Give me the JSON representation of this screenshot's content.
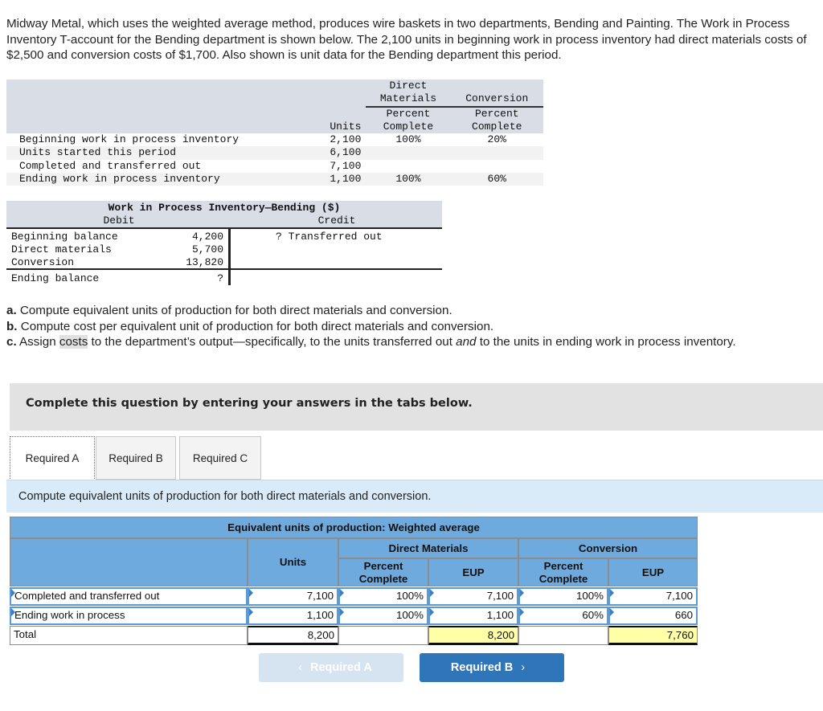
{
  "intro": "Midway Metal, which uses the weighted average method, produces wire baskets in two departments, Bending and Painting. The Work in Process Inventory T-account for the Bending department is shown below. The 2,100 units in beginning work in process inventory had direct materials costs of $2,500 and conversion costs of $1,700. Also shown is unit data for the Bending department this period.",
  "unit_table": {
    "headers": {
      "dm_top1": "Direct",
      "dm_top2": "Materials",
      "conv_top": "Conversion",
      "units": "Units",
      "pc1": "Percent",
      "pc2": "Complete"
    },
    "rows": [
      {
        "label": "Beginning work in process inventory",
        "units": "2,100",
        "dm": "100%",
        "conv": "20%"
      },
      {
        "label": "Units started this period",
        "units": "6,100",
        "dm": "",
        "conv": ""
      },
      {
        "label": "Completed and transferred out",
        "units": "7,100",
        "dm": "",
        "conv": ""
      },
      {
        "label": "Ending work in process inventory",
        "units": "1,100",
        "dm": "100%",
        "conv": "60%"
      }
    ]
  },
  "t_account": {
    "title": "Work in Process Inventory—Bending ($)",
    "debit": "Debit",
    "credit": "Credit",
    "debits": [
      {
        "label": "Beginning balance",
        "value": "4,200"
      },
      {
        "label": "Direct materials",
        "value": "5,700"
      },
      {
        "label": "Conversion",
        "value": "13,820"
      }
    ],
    "ending": {
      "label": "Ending balance",
      "value": "?"
    },
    "credit_entry": "? Transferred out"
  },
  "requirements": {
    "a_prefix": "a.",
    "a": " Compute equivalent units of production for both direct materials and conversion.",
    "b_prefix": "b.",
    "b": " Compute cost per equivalent unit of production for both direct materials and conversion.",
    "c_prefix": "c.",
    "c_1": " Assign ",
    "c_hl": "costs",
    "c_2": " to the department’s output—specifically, to the units transferred out ",
    "c_and": "and",
    "c_3": " to the units in ending work in process inventory."
  },
  "banner": "Complete this question by entering your answers in the tabs below.",
  "tabs": [
    {
      "label": "Required A",
      "active": true
    },
    {
      "label": "Required B",
      "active": false
    },
    {
      "label": "Required C",
      "active": false
    }
  ],
  "instruction": "Compute equivalent units of production for both direct materials and conversion.",
  "eup_table": {
    "title": "Equivalent units of production: Weighted average",
    "units_header": "Units",
    "dm_header": "Direct Materials",
    "conv_header": "Conversion",
    "pc_header": "Percent Complete",
    "eup_header": "EUP",
    "rows": [
      {
        "label": "Completed and transferred out",
        "units": "7,100",
        "dm_pct": "100%",
        "dm_eup": "7,100",
        "conv_pct": "100%",
        "conv_eup": "7,100"
      },
      {
        "label": "Ending work in process",
        "units": "1,100",
        "dm_pct": "100%",
        "dm_eup": "1,100",
        "conv_pct": "60%",
        "conv_eup": "660"
      }
    ],
    "total": {
      "label": "Total",
      "units": "8,200",
      "dm_eup": "8,200",
      "conv_eup": "7,760"
    }
  },
  "nav": {
    "prev_label": "Required A",
    "next_label": "Required B",
    "prev_icon": "‹",
    "next_icon": "›"
  }
}
